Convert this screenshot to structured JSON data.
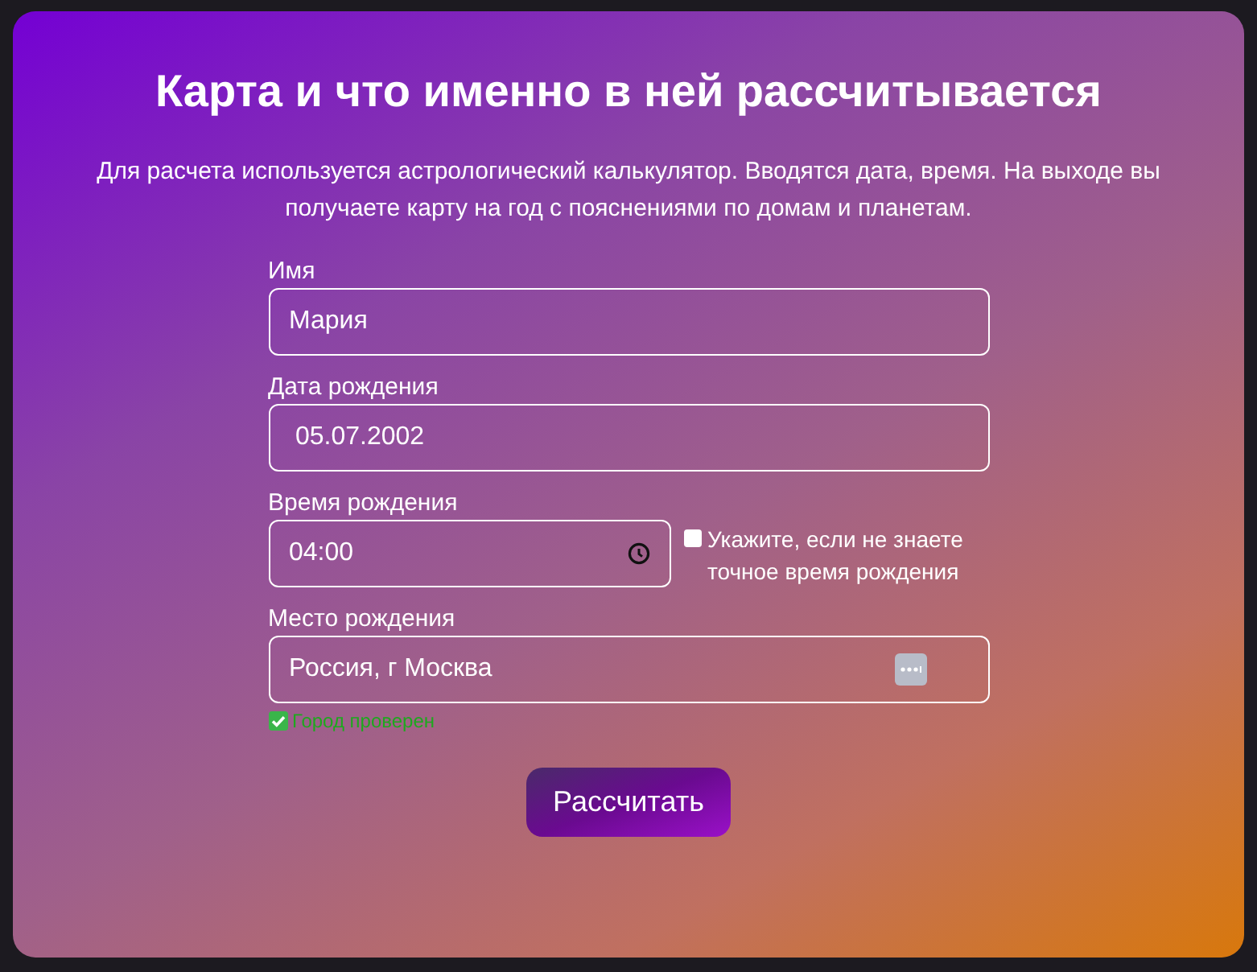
{
  "title": "Карта и что именно в ней рассчитывается",
  "description": "Для расчета используется астрологический калькулятор. Вводятся дата, время. На выходе вы получаете карту на год с пояснениями по домам и планетам.",
  "fields": [
    {
      "kind": "text",
      "label": "Имя",
      "value": "Мария"
    },
    {
      "kind": "date",
      "label": "Дата рождения",
      "value": "05.07.2002"
    },
    {
      "kind": "time",
      "label": "Время рождения",
      "value": "04:00",
      "checkbox": {
        "label": "Укажите, если не знаете точное время рождения",
        "checked": false
      }
    },
    {
      "kind": "place",
      "label": "Место рождения",
      "value": "Россия, г Москва",
      "status": {
        "text": "Город проверен",
        "verified": true
      }
    }
  ],
  "submit": "Рассчитать"
}
